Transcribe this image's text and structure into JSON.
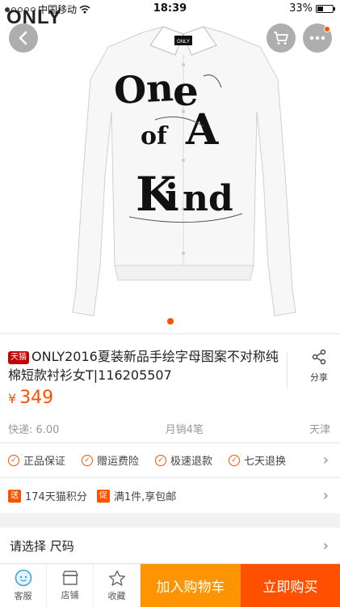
{
  "status_bar": {
    "carrier": "中国移动",
    "time": "18:39",
    "battery": "33%",
    "battery_level": 0.33
  },
  "brand_logo": "ONLY",
  "hero": {
    "shirt_print_text": "One of A Kind",
    "brand_label": "ONLY",
    "page_total": 1,
    "page_current": 1
  },
  "product": {
    "tmall_tag": "天猫",
    "title": "ONLY2016夏装新品手绘字母图案不对称纯棉短款衬衫女T|116205507",
    "share_label": "分享",
    "price_symbol": "¥",
    "price": "349",
    "shipping": "快递: 6.00",
    "monthly_sales": "月销4笔",
    "location": "天津"
  },
  "guarantees": [
    "正品保证",
    "赠运费险",
    "极速退款",
    "七天退换"
  ],
  "promos": [
    {
      "tag": "送",
      "text": "174天猫积分"
    },
    {
      "tag": "促",
      "text": "满1件,享包邮"
    }
  ],
  "select_row": {
    "label": "请选择 尺码"
  },
  "bottom_bar": {
    "service_label": "客服",
    "store_label": "店铺",
    "favorite_label": "收藏",
    "add_cart_label": "加入购物车",
    "buy_now_label": "立即购买"
  },
  "colors": {
    "accent": "#ff5000",
    "add_cart": "#ff9402",
    "tmall_red": "#c40000"
  }
}
